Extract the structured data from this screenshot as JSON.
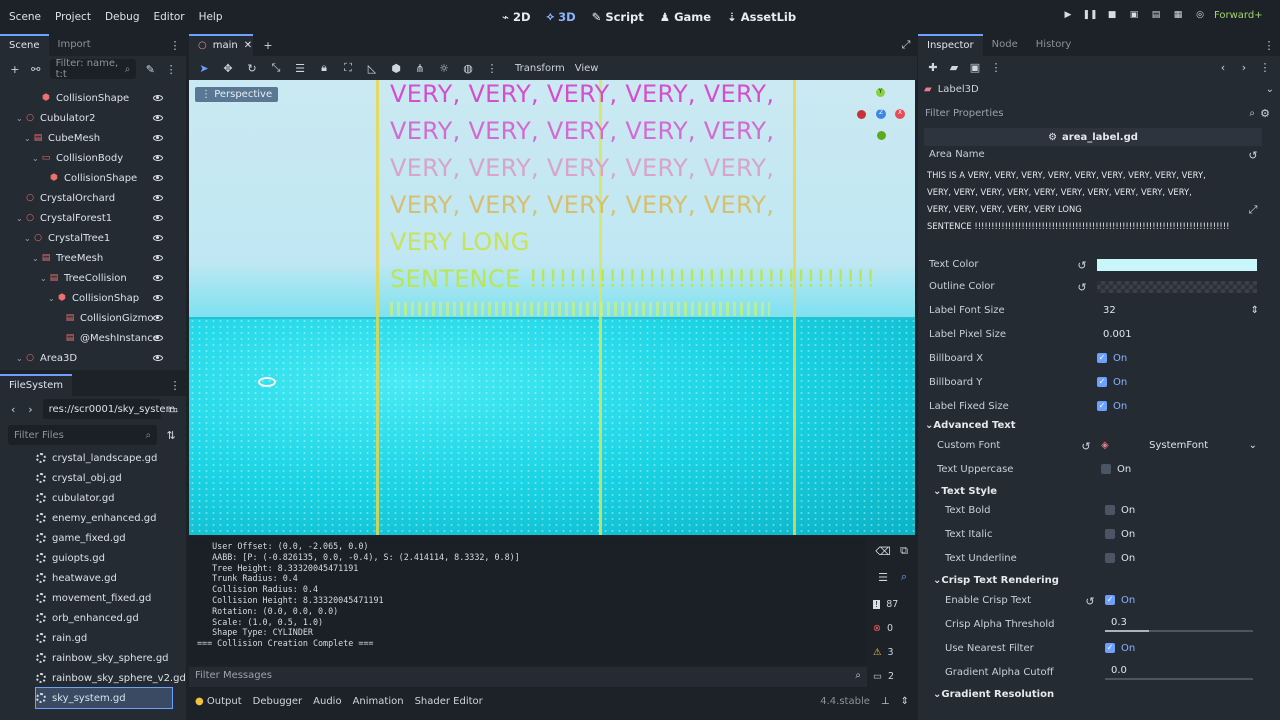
{
  "menu": [
    "Scene",
    "Project",
    "Debug",
    "Editor",
    "Help"
  ],
  "workspaces": [
    {
      "label": "2D",
      "icon": "2d-icon"
    },
    {
      "label": "3D",
      "icon": "3d-icon"
    },
    {
      "label": "Script",
      "icon": "script-icon"
    },
    {
      "label": "Game",
      "icon": "game-icon"
    },
    {
      "label": "AssetLib",
      "icon": "assetlib-icon"
    }
  ],
  "renderer": "Forward+",
  "scene_panel": {
    "tabs": [
      "Scene",
      "Import"
    ],
    "filter_placeholder": "Filter: name, t:t"
  },
  "scene_tree": [
    {
      "label": "CollisionShape",
      "indent": 3
    },
    {
      "label": "Cubulator2",
      "indent": 1
    },
    {
      "label": "CubeMesh",
      "indent": 2
    },
    {
      "label": "CollisionBody",
      "indent": 3
    },
    {
      "label": "CollisionShape",
      "indent": 4
    },
    {
      "label": "CrystalOrchard",
      "indent": 1
    },
    {
      "label": "CrystalForest1",
      "indent": 1
    },
    {
      "label": "CrystalTree1",
      "indent": 2
    },
    {
      "label": "TreeMesh",
      "indent": 3
    },
    {
      "label": "TreeCollision",
      "indent": 4
    },
    {
      "label": "CollisionShap",
      "indent": 5
    },
    {
      "label": "CollisionGizmo",
      "indent": 6
    },
    {
      "label": "@MeshInstance",
      "indent": 6
    },
    {
      "label": "Area3D",
      "indent": 1
    }
  ],
  "filesystem": {
    "title": "FileSystem",
    "path": "res://scr0001/sky_system.",
    "filter_placeholder": "Filter Files",
    "files": [
      "crystal_landscape.gd",
      "crystal_obj.gd",
      "cubulator.gd",
      "enemy_enhanced.gd",
      "game_fixed.gd",
      "guiopts.gd",
      "heatwave.gd",
      "movement_fixed.gd",
      "orb_enhanced.gd",
      "rain.gd",
      "rainbow_sky_sphere.gd",
      "rainbow_sky_sphere_v2.gd",
      "sky_system.gd"
    ]
  },
  "editor_tab": "main",
  "viewport": {
    "toolbar": {
      "transform": "Transform",
      "view": "View"
    },
    "perspective": "Perspective",
    "label_lines": [
      "VERY, VERY, VERY, VERY, VERY,",
      "VERY, VERY, VERY, VERY, VERY,",
      "VERY, VERY, VERY, VERY, VERY,",
      "VERY, VERY, VERY, VERY, VERY,",
      "VERY LONG",
      "SENTENCE !!!!!!!!!!!!!!!!!!!!!!!!!!!!!!!!!!!"
    ],
    "line_colors": [
      "#d44fd0",
      "#d36bd4",
      "#d8a4c8",
      "#d6c070",
      "#c8e25a",
      "#b9e655"
    ]
  },
  "output": {
    "lines": [
      "   User Offset: (0.0, -2.065, 0.0)",
      "   AABB: [P: (-0.826135, 0.0, -0.4), S: (2.414114, 8.3332, 0.8)]",
      "   Tree Height: 8.33320045471191",
      "   Trunk Radius: 0.4",
      "   Collision Radius: 0.4",
      "   Collision Height: 8.33320045471191",
      "   Rotation: (0.0, 0.0, 0.0)",
      "   Scale: (1.0, 0.5, 1.0)",
      "   Shape Type: CYLINDER",
      "=== Collision Creation Complete ==="
    ],
    "counts": [
      "87",
      "0",
      "3",
      "2"
    ],
    "filter_placeholder": "Filter Messages",
    "tabs": [
      "Output",
      "Debugger",
      "Audio",
      "Animation",
      "Shader Editor"
    ],
    "version": "4.4.stable"
  },
  "inspector": {
    "tabs": [
      "Inspector",
      "Node",
      "History"
    ],
    "node": "Label3D",
    "filter_placeholder": "Filter Properties",
    "script": "area_label.gd",
    "area_name_label": "Area Name",
    "area_name_lines": [
      "THIS IS A VERY,  VERY,  VERY,  VERY,  VERY,  VERY,  VERY,  VERY,  VERY,",
      "VERY,  VERY,  VERY,  VERY,  VERY,  VERY,  VERY,  VERY,  VERY,  VERY,",
      "VERY,  VERY,  VERY,  VERY,  VERY LONG",
      "SENTENCE !!!!!!!!!!!!!!!!!!!!!!!!!!!!!!!!!!!!!!!!!!!!!!!!!!!!!!!!!!!!!!!!!!!!!!!!!!!!"
    ],
    "text_color_label": "Text Color",
    "text_color": "#c9f6fb",
    "outline_color_label": "Outline Color",
    "font_size_label": "Label Font Size",
    "font_size": "32",
    "pixel_size_label": "Label Pixel Size",
    "pixel_size": "0.001",
    "billboard_x_label": "Billboard X",
    "billboard_y_label": "Billboard Y",
    "fixed_size_label": "Label Fixed Size",
    "on": "On",
    "advanced_text": "Advanced Text",
    "custom_font_label": "Custom Font",
    "custom_font": "SystemFont",
    "uppercase_label": "Text Uppercase",
    "text_style": "Text Style",
    "bold_label": "Text Bold",
    "italic_label": "Text Italic",
    "underline_label": "Text Underline",
    "crisp": "Crisp Text Rendering",
    "enable_crisp_label": "Enable Crisp Text",
    "alpha_threshold_label": "Crisp Alpha Threshold",
    "alpha_threshold": "0.3",
    "nearest_label": "Use Nearest Filter",
    "gradient_cutoff_label": "Gradient Alpha Cutoff",
    "gradient_cutoff": "0.0",
    "gradient_resolution": "Gradient Resolution"
  }
}
